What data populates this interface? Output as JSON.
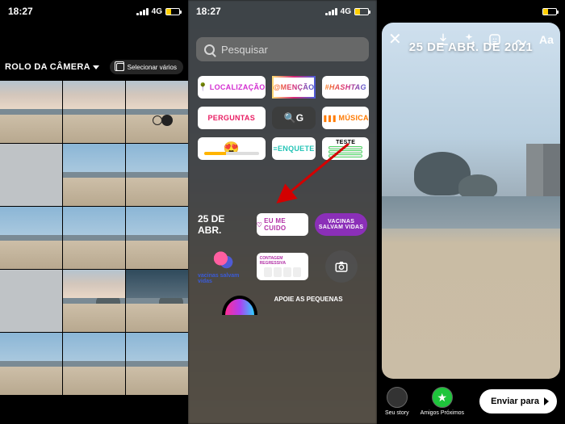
{
  "status": {
    "time": "18:27",
    "network": "4G"
  },
  "panel1": {
    "source_label": "ROLO DA CÂMERA",
    "select_multiple": "Selecionar vários"
  },
  "panel2": {
    "search_placeholder": "Pesquisar",
    "stickers": {
      "location": "LOCALIZAÇÃO",
      "mention": "@MENÇÃO",
      "hashtag": "#HASHTAG",
      "questions": "PERGUNTAS",
      "gif": "G",
      "music": "MÚSICA",
      "emoji_slider": "😍",
      "poll": "ENQUETE",
      "quiz": "TESTE",
      "date": "25 DE ABR.",
      "eu_me_cuido": "EU ME CUIDO",
      "vacinas": "VACINAS SALVAM VIDAS",
      "vacinas2": "vacinas salvam vidas",
      "countdown": "CONTAGEM REGRESSIVA",
      "apoie": "APOIE AS PEQUENAS"
    }
  },
  "panel3": {
    "date_label": "25 DE ABR. DE 2021",
    "text_tool": "Aa",
    "your_story": "Seu story",
    "close_friends": "Amigos Próximos",
    "send_to": "Enviar para"
  }
}
